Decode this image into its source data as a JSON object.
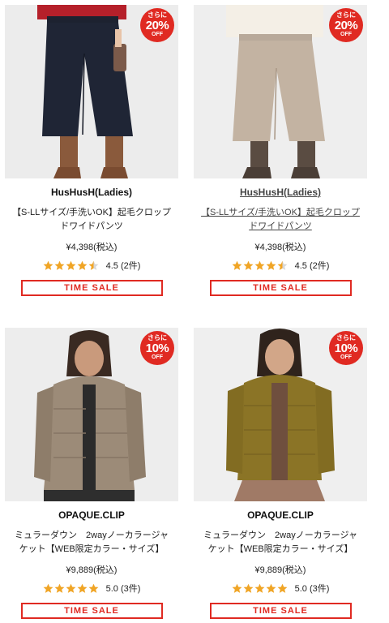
{
  "products": [
    {
      "brand": "HusHusH(Ladies)",
      "name": "【S-LLサイズ/手洗いOK】起毛クロップドワイドパンツ",
      "price": "¥4,398(税込)",
      "rating_value": 4.5,
      "rating_text": "4.5 (2件)",
      "badge": {
        "top": "さらに",
        "pct": "20%",
        "off": "OFF"
      },
      "sale_label": "TIME SALE",
      "image": "navy-wide-pants"
    },
    {
      "brand": "HusHusH(Ladies)",
      "name": "【S-LLサイズ/手洗いOK】起毛クロップドワイドパンツ",
      "price": "¥4,398(税込)",
      "rating_value": 4.5,
      "rating_text": "4.5 (2件)",
      "badge": {
        "top": "さらに",
        "pct": "20%",
        "off": "OFF"
      },
      "sale_label": "TIME SALE",
      "image": "beige-wide-pants"
    },
    {
      "brand": "OPAQUE.CLIP",
      "name": "ミュラーダウン　2wayノーカラージャケット【WEB限定カラー・サイズ】",
      "price": "¥9,889(税込)",
      "rating_value": 5.0,
      "rating_text": "5.0 (3件)",
      "badge": {
        "top": "さらに",
        "pct": "10%",
        "off": "OFF"
      },
      "sale_label": "TIME SALE",
      "image": "beige-down-jacket"
    },
    {
      "brand": "OPAQUE.CLIP",
      "name": "ミュラーダウン　2wayノーカラージャケット【WEB限定カラー・サイズ】",
      "price": "¥9,889(税込)",
      "rating_value": 5.0,
      "rating_text": "5.0 (3件)",
      "badge": {
        "top": "さらに",
        "pct": "10%",
        "off": "OFF"
      },
      "sale_label": "TIME SALE",
      "image": "olive-down-jacket"
    }
  ],
  "colors": {
    "accent": "#e02a22",
    "star": "#f0a526",
    "star_empty": "#d8d8d8"
  }
}
